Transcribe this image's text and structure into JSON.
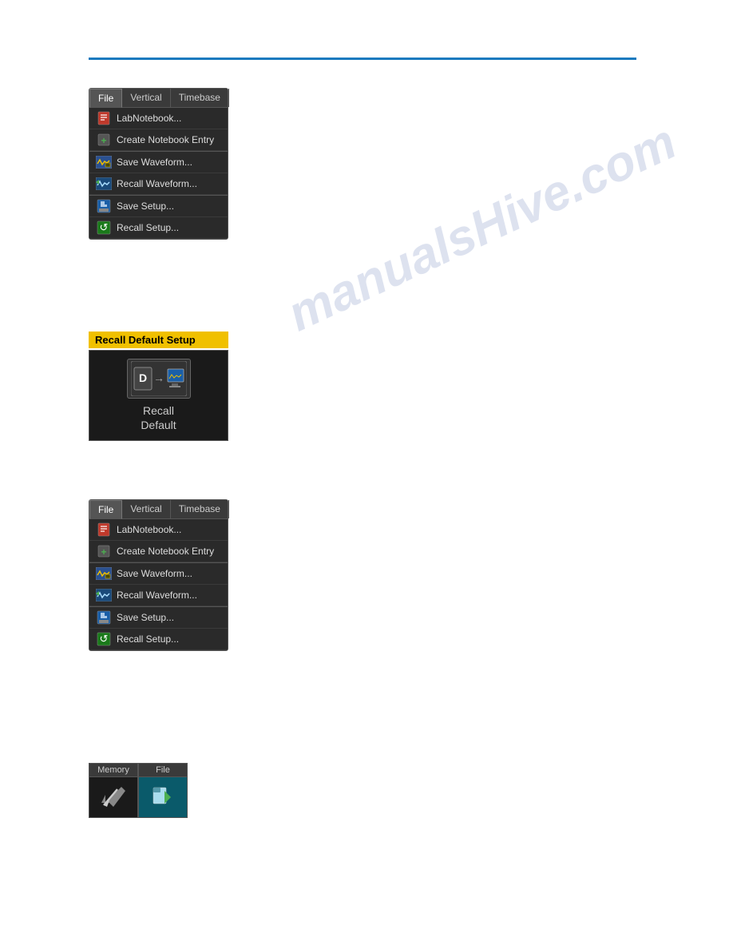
{
  "page": {
    "background": "#ffffff",
    "watermark": "manualsHive.com"
  },
  "panel_top": {
    "tabs": [
      {
        "label": "File",
        "active": true
      },
      {
        "label": "Vertical",
        "active": false
      },
      {
        "label": "Timebase",
        "active": false
      }
    ],
    "items": [
      {
        "label": "LabNotebook...",
        "icon": "notebook-icon"
      },
      {
        "label": "Create Notebook Entry",
        "icon": "create-entry-icon"
      },
      {
        "label": "Save Waveform...",
        "icon": "save-waveform-icon"
      },
      {
        "label": "Recall Waveform...",
        "icon": "recall-waveform-icon"
      },
      {
        "label": "Save Setup...",
        "icon": "save-setup-icon"
      },
      {
        "label": "Recall Setup...",
        "icon": "recall-setup-icon"
      }
    ]
  },
  "recall_default": {
    "label": "Recall Default Setup",
    "button_text_line1": "Recall",
    "button_text_line2": "Default"
  },
  "panel_bottom": {
    "tabs": [
      {
        "label": "File",
        "active": true
      },
      {
        "label": "Vertical",
        "active": false
      },
      {
        "label": "Timebase",
        "active": false
      }
    ],
    "items": [
      {
        "label": "LabNotebook...",
        "icon": "notebook-icon"
      },
      {
        "label": "Create Notebook Entry",
        "icon": "create-entry-icon"
      },
      {
        "label": "Save Waveform...",
        "icon": "save-waveform-icon"
      },
      {
        "label": "Recall Waveform...",
        "icon": "recall-waveform-icon"
      },
      {
        "label": "Save Setup...",
        "icon": "save-setup-icon"
      },
      {
        "label": "Recall Setup...",
        "icon": "recall-setup-icon"
      }
    ]
  },
  "memory_file_panel": {
    "tabs": [
      {
        "label": "Memory",
        "active": false
      },
      {
        "label": "File",
        "active": true
      }
    ]
  }
}
